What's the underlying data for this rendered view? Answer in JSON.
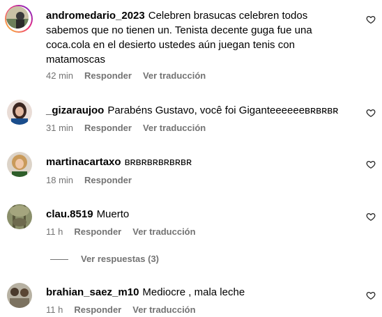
{
  "comments": [
    {
      "username": "andromedario_2023",
      "text": "Celebren brasucas celebren todos sabemos que no tienen un. Tenista decente guga fue una coca.cola en el desierto ustedes aún juegan tenis con matamoscas",
      "time": "42 min",
      "reply_label": "Responder",
      "translate_label": "Ver traducción"
    },
    {
      "username": "_gizaraujoo",
      "text": "Parabéns Gustavo, você foi Giganteeeeeeʙʀʙʀʙʀ",
      "time": "31 min",
      "reply_label": "Responder",
      "translate_label": "Ver traducción"
    },
    {
      "username": "martinacartaxo",
      "text": "ʙʀʙʀʙʀʙʀʙʀʙʀ",
      "time": "18 min",
      "reply_label": "Responder"
    },
    {
      "username": "clau.8519",
      "text": "Muerto",
      "time": "11 h",
      "reply_label": "Responder",
      "translate_label": "Ver traducción",
      "view_replies": "Ver respuestas (3)"
    },
    {
      "username": "brahian_saez_m10",
      "text": "Mediocre , mala leche",
      "time": "11 h",
      "reply_label": "Responder",
      "translate_label": "Ver traducción"
    }
  ],
  "icons": {
    "like": "heart-outline-icon"
  },
  "colors": {
    "meta": "#737373",
    "story_ring": "#ee2a7b"
  }
}
